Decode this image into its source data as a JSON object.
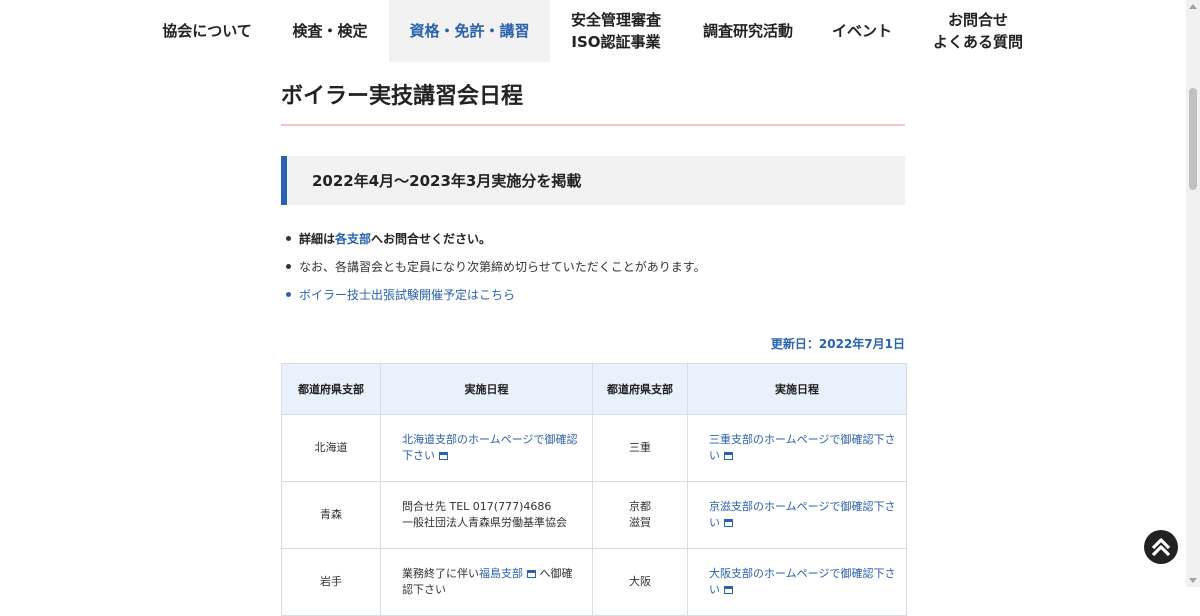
{
  "nav": {
    "items": [
      {
        "label": "協会について"
      },
      {
        "label": "検査・検定"
      },
      {
        "label": "資格・免許・講習",
        "active": true
      },
      {
        "label": "安全管理審査\nISO認証事業"
      },
      {
        "label": "調査研究活動"
      },
      {
        "label": "イベント"
      },
      {
        "label": "お問合せ\nよくある質問"
      }
    ]
  },
  "page": {
    "title": "ボイラー実技講習会日程",
    "banner": "2022年4月〜2023年3月実施分を掲載",
    "notes": {
      "detail_prefix": "詳細は",
      "detail_link": "各支部",
      "detail_suffix": "へお問合せください。",
      "capacity": "なお、各講習会とも定員になり次第締め切らせていただくことがあります。",
      "exam_link": "ボイラー技士出張試験開催予定はこちら"
    },
    "updated": "更新日：2022年7月1日"
  },
  "table": {
    "headers": [
      "都道府県支部",
      "実施日程",
      "都道府県支部",
      "実施日程"
    ],
    "rows": [
      {
        "left_pref": "北海道",
        "left_sched_link": "北海道支部のホームページで御確認下さい",
        "right_pref": "三重",
        "right_sched_link": "三重支部のホームページで御確認下さい"
      },
      {
        "left_pref": "青森",
        "left_sched_line1": "問合せ先 TEL 017(777)4686",
        "left_sched_line2": "一般社団法人青森県労働基準協会",
        "right_pref_line1": "京都",
        "right_pref_line2": "滋賀",
        "right_sched_link": "京滋支部のホームページで御確認下さい"
      },
      {
        "left_pref": "岩手",
        "left_sched_prefix": "業務終了に伴い",
        "left_sched_link": "福島支部",
        "left_sched_suffix": "へ御確認下さい",
        "right_pref": "大阪",
        "right_sched_link": "大阪支部のホームページで御確認下さい"
      }
    ]
  }
}
